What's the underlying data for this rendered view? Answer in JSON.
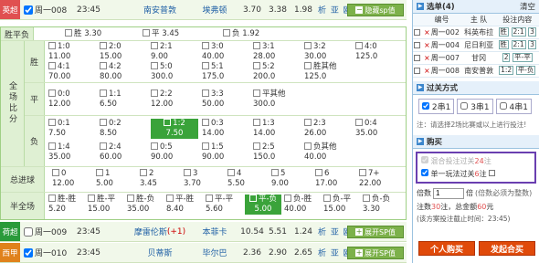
{
  "matches_top": [
    {
      "league": "英超",
      "league_color": "#e05050",
      "code": "周一008",
      "time": "23:45",
      "home": "南安普敦",
      "away": "埃弗顿",
      "odds": [
        "3.70",
        "3.38",
        "1.98"
      ],
      "analysis": "析 亚 欧",
      "sp_label": "隐藏sp值"
    }
  ],
  "sections": {
    "wdl": {
      "label": "胜平负",
      "items": [
        {
          "name": "胜",
          "odd": "3.30"
        },
        {
          "name": "平",
          "odd": "3.45"
        },
        {
          "name": "负",
          "odd": "1.92"
        }
      ]
    },
    "score": {
      "label": "全场比分",
      "row_labels": [
        "胜",
        "平",
        "负"
      ],
      "win": [
        {
          "s": "1:0",
          "o": "11.00"
        },
        {
          "s": "2:0",
          "o": "15.00"
        },
        {
          "s": "2:1",
          "o": "9.00"
        },
        {
          "s": "3:0",
          "o": "40.00"
        },
        {
          "s": "3:1",
          "o": "28.00"
        },
        {
          "s": "3:2",
          "o": "30.00"
        },
        {
          "s": "4:0",
          "o": "125.0"
        },
        {
          "s": "4:1",
          "o": "70.00"
        },
        {
          "s": "4:2",
          "o": "80.00"
        },
        {
          "s": "5:0",
          "o": "300.0"
        },
        {
          "s": "5:1",
          "o": "175.0"
        },
        {
          "s": "5:2",
          "o": "200.0"
        },
        {
          "s": "胜其他",
          "o": "125.0"
        }
      ],
      "draw": [
        {
          "s": "0:0",
          "o": "12.00"
        },
        {
          "s": "1:1",
          "o": "6.50"
        },
        {
          "s": "2:2",
          "o": "12.00"
        },
        {
          "s": "3:3",
          "o": "50.00"
        },
        {
          "s": "平其他",
          "o": "300.0"
        }
      ],
      "lose": [
        {
          "s": "0:1",
          "o": "7.50"
        },
        {
          "s": "0:2",
          "o": "8.50"
        },
        {
          "s": "1:2",
          "o": "7.50"
        },
        {
          "s": "0:3",
          "o": "14.00"
        },
        {
          "s": "1:3",
          "o": "14.00"
        },
        {
          "s": "2:3",
          "o": "26.00"
        },
        {
          "s": "0:4",
          "o": "35.00"
        },
        {
          "s": "1:4",
          "o": "35.00"
        },
        {
          "s": "2:4",
          "o": "60.00"
        },
        {
          "s": "0:5",
          "o": "90.00"
        },
        {
          "s": "1:5",
          "o": "90.00"
        },
        {
          "s": "2:5",
          "o": "150.0"
        },
        {
          "s": "负其他",
          "o": "40.00"
        }
      ]
    },
    "goals": {
      "label": "总进球",
      "items": [
        {
          "s": "0",
          "o": "12.00"
        },
        {
          "s": "1",
          "o": "5.00"
        },
        {
          "s": "2",
          "o": "3.45"
        },
        {
          "s": "3",
          "o": "3.70"
        },
        {
          "s": "4",
          "o": "5.50"
        },
        {
          "s": "5",
          "o": "9.00"
        },
        {
          "s": "6",
          "o": "17.00"
        },
        {
          "s": "7+",
          "o": "22.00"
        }
      ]
    },
    "htft": {
      "label": "半全场",
      "items": [
        {
          "s": "胜-胜",
          "o": "5.20"
        },
        {
          "s": "胜-平",
          "o": "15.00"
        },
        {
          "s": "胜-负",
          "o": "35.00"
        },
        {
          "s": "平-胜",
          "o": "8.40"
        },
        {
          "s": "平-平",
          "o": "5.60"
        },
        {
          "s": "平-负",
          "o": "5.00"
        },
        {
          "s": "负-胜",
          "o": "40.00"
        },
        {
          "s": "负-平",
          "o": "15.00"
        },
        {
          "s": "负-负",
          "o": "3.30"
        }
      ]
    }
  },
  "matches_bottom": [
    {
      "league": "荷超",
      "league_color": "#2a9a3a",
      "code": "周一009",
      "time": "23:45",
      "home": "摩雷伦斯",
      "handicap": "(+1)",
      "away": "本菲卡",
      "odds": [
        "10.54",
        "5.51",
        "1.24"
      ],
      "analysis": "析 亚 欧",
      "sp_label": "展开SP值"
    },
    {
      "league": "西甲",
      "league_color": "#e0821c",
      "code": "周一010",
      "time": "23:45",
      "home": "贝蒂斯",
      "handicap": "",
      "away": "毕尔巴",
      "odds": [
        "2.36",
        "2.90",
        "2.65"
      ],
      "analysis": "析 亚 欧",
      "sp_label": "展开SP值"
    }
  ],
  "panel": {
    "selection_title": "选单(4)",
    "clear_label": "清空",
    "headers": [
      "编号",
      "主 队",
      "投注内容"
    ],
    "rows": [
      {
        "code": "周一002",
        "team": "科英布拉",
        "picks": [
          "胜",
          "2:1",
          "3"
        ]
      },
      {
        "code": "周一004",
        "team": "尼日利亚",
        "picks": [
          "胜",
          "2:1",
          "3"
        ]
      },
      {
        "code": "周一007",
        "team": "甘冈",
        "picks": [
          "2",
          "平-平"
        ]
      },
      {
        "code": "周一008",
        "team": "南安普敦",
        "picks": [
          "1:2",
          "平-负"
        ]
      }
    ],
    "pass_title": "过关方式",
    "pass_options": [
      "2串1",
      "3串1",
      "4串1"
    ],
    "pass_note": "注：请选择2场比赛或以上进行投注!",
    "buy_title": "购买",
    "mix_label": "混合投注过关",
    "mix_count": "24",
    "mix_suffix": "注",
    "single_label": "单一玩法过关",
    "single_count": "6",
    "single_suffix": "注",
    "multiple_label": "倍数",
    "multiple_value": "1",
    "multiple_unit": "倍",
    "multiple_note": "(倍数必须为整数)",
    "bets_line_a": "注数",
    "bets_count": "30",
    "bets_line_b": "注，总金额",
    "amount": "60",
    "amount_unit": "元",
    "deadline": "(该方案投注截止时间：23:45)",
    "btn_buy": "个人购买",
    "btn_group": "发起合买"
  }
}
